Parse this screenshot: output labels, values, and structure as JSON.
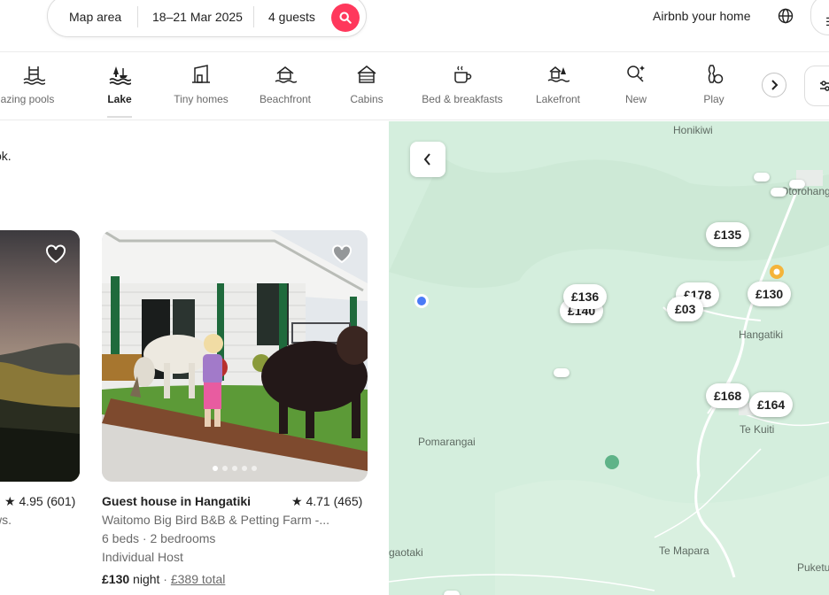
{
  "search": {
    "location": "Map area",
    "dates": "18–21 Mar 2025",
    "guests": "4 guests"
  },
  "header": {
    "host_link": "Airbnb your home"
  },
  "categories": [
    {
      "label": "Amazing pools",
      "icon": "pool-icon"
    },
    {
      "label": "Lake",
      "icon": "lake-icon",
      "active": true
    },
    {
      "label": "Tiny homes",
      "icon": "tiny-home-icon"
    },
    {
      "label": "Beachfront",
      "icon": "beachfront-icon"
    },
    {
      "label": "Cabins",
      "icon": "cabin-icon"
    },
    {
      "label": "Bed & breakfasts",
      "icon": "coffee-cup-icon"
    },
    {
      "label": "Lakefront",
      "icon": "lakefront-icon"
    },
    {
      "label": "New",
      "icon": "new-key-icon"
    },
    {
      "label": "Play",
      "icon": "bowling-icon"
    }
  ],
  "listings": {
    "notice_fragment": "ok.",
    "cards": [
      {
        "rating": "4.95 (601)",
        "subtitle_fragment": "ws."
      },
      {
        "title": "Guest house in Hangatiki",
        "rating": "4.71 (465)",
        "subtitle": "Waitomo Big Bird B&B & Petting Farm -...",
        "beds": "6 beds · 2 bedrooms",
        "host": "Individual Host",
        "price": "£130",
        "price_unit": "night",
        "separator": "·",
        "total": "£389 total"
      }
    ]
  },
  "map": {
    "places": [
      "Honikiwi",
      "Otorohanga",
      "Hangatiki",
      "Te Kuiti",
      "Pomarangai",
      "gaotaki",
      "Te Mapara",
      "Puketu"
    ],
    "price_pins": [
      "£135",
      "£136",
      "£140",
      "£178",
      "£03",
      "£130",
      "£168",
      "£164"
    ],
    "colors": {
      "land": "#d4eedd",
      "road": "#ffffff",
      "pin_bg": "#ffffff",
      "brand": "#ff385c",
      "location_dot": "#4a7bf7"
    }
  }
}
